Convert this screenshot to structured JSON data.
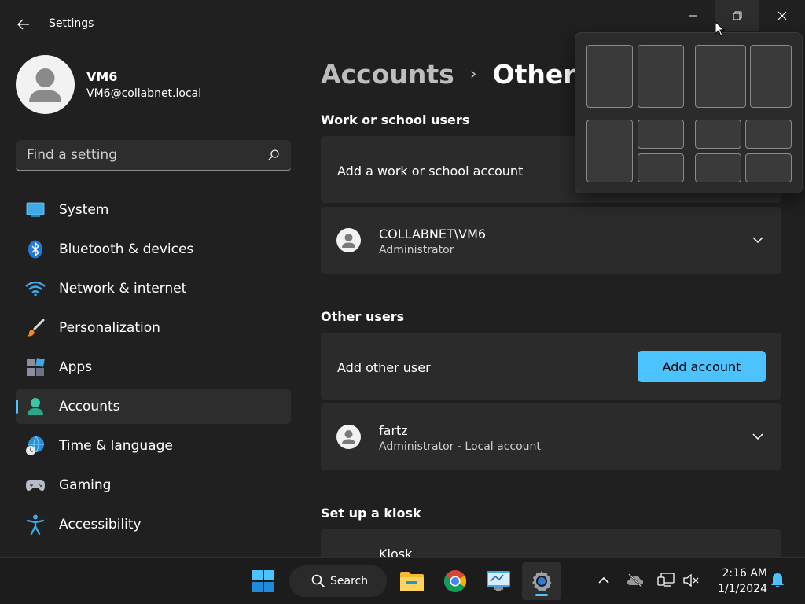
{
  "window": {
    "title": "Settings",
    "back_icon": "arrow-left-icon",
    "controls": {
      "minimize_icon": "minimize-icon",
      "maximize_icon": "restore-icon",
      "close_icon": "close-icon"
    }
  },
  "profile": {
    "name": "VM6",
    "email": "VM6@collabnet.local"
  },
  "search": {
    "placeholder": "Find a setting",
    "icon": "search-icon"
  },
  "sidebar": {
    "items": [
      {
        "label": "System",
        "icon": "system-icon"
      },
      {
        "label": "Bluetooth & devices",
        "icon": "bluetooth-icon"
      },
      {
        "label": "Network & internet",
        "icon": "wifi-icon"
      },
      {
        "label": "Personalization",
        "icon": "paintbrush-icon"
      },
      {
        "label": "Apps",
        "icon": "apps-icon"
      },
      {
        "label": "Accounts",
        "icon": "accounts-icon",
        "active": true
      },
      {
        "label": "Time & language",
        "icon": "globe-clock-icon"
      },
      {
        "label": "Gaming",
        "icon": "gamepad-icon"
      },
      {
        "label": "Accessibility",
        "icon": "accessibility-icon"
      }
    ]
  },
  "breadcrumb": {
    "parent": "Accounts",
    "separator": "›",
    "current": "Other U"
  },
  "sections": {
    "work": {
      "header": "Work or school users",
      "add_label": "Add a work or school account",
      "user": {
        "name": "COLLABNET\\VM6",
        "role": "Administrator"
      }
    },
    "other": {
      "header": "Other users",
      "add_label": "Add other user",
      "button_label": "Add account",
      "user": {
        "name": "fartz",
        "role": "Administrator - Local account"
      }
    },
    "kiosk": {
      "header": "Set up a kiosk",
      "label": "Kiosk"
    }
  },
  "taskbar": {
    "search_label": "Search",
    "apps": [
      "start-icon",
      "file-explorer-icon",
      "chrome-icon",
      "remote-desktop-icon",
      "settings-icon"
    ],
    "tray": [
      "chevron-up-icon",
      "onedrive-offline-icon",
      "network-icon",
      "volume-muted-icon",
      "notification-bell-icon"
    ],
    "time": "2:16 AM",
    "date": "1/1/2024"
  },
  "colors": {
    "accent": "#4cc2ff",
    "background": "#202020",
    "card": "#2b2b2b"
  }
}
